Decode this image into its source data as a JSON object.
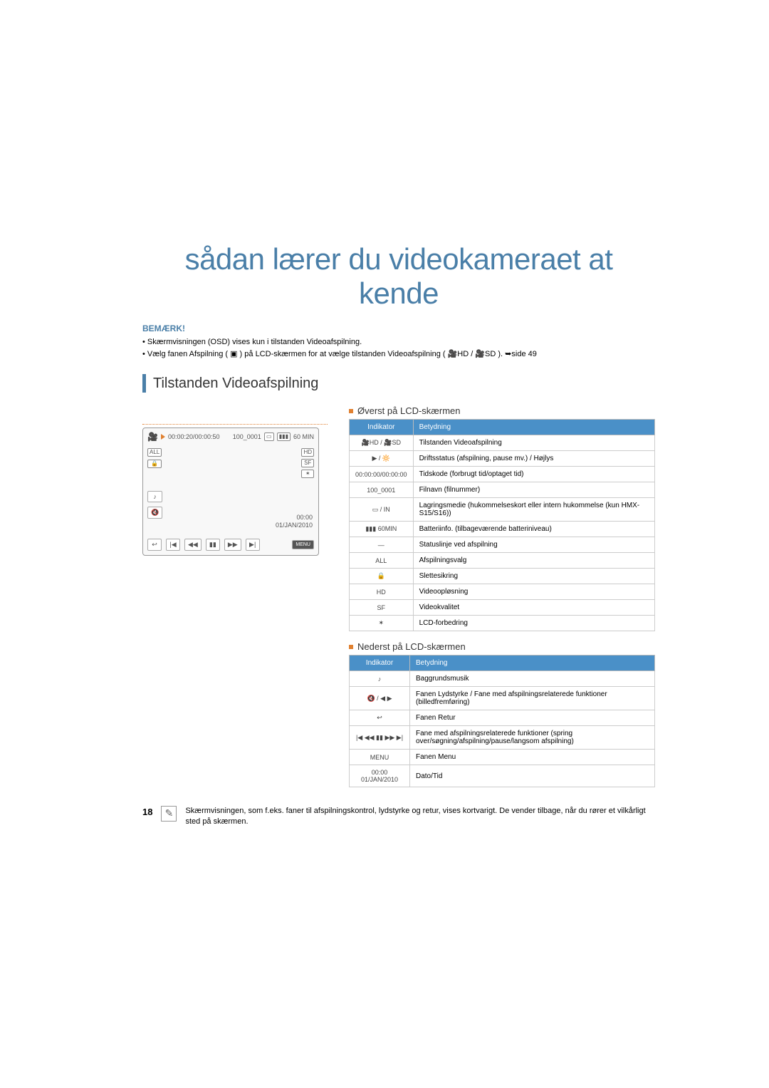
{
  "page": {
    "title": "sådan lærer du videokameraet at kende",
    "note_label": "BEMÆRK!",
    "notes": [
      "Skærmvisningen (OSD) vises kun i tilstanden Videoafspilning.",
      "Vælg fanen Afspilning ( ▣ ) på LCD-skærmen for at vælge tilstanden Videoafspilning ( 🎥HD / 🎥SD ). ➥side 49"
    ],
    "section_title": "Tilstanden Videoafspilning",
    "subhead_top": "Øverst på LCD-skærmen",
    "subhead_bottom": "Nederst på LCD-skærmen",
    "table_headers": {
      "indicator": "Indikator",
      "meaning": "Betydning"
    },
    "top_table": [
      {
        "icon": "🎥HD / 🎥SD",
        "meaning": "Tilstanden Videoafspilning"
      },
      {
        "icon": "▶ / 🔆",
        "meaning": "Driftsstatus (afspilning, pause mv.) / Højlys"
      },
      {
        "icon": "00:00:00/00:00:00",
        "meaning": "Tidskode (forbrugt tid/optaget tid)"
      },
      {
        "icon": "100_0001",
        "meaning": "Filnavn (filnummer)"
      },
      {
        "icon": "▭ / IN",
        "meaning": "Lagringsmedie (hukommelseskort eller intern hukommelse (kun HMX-S15/S16))"
      },
      {
        "icon": "▮▮▮ 60MIN",
        "meaning": "Batteriinfo. (tilbageværende batteriniveau)"
      },
      {
        "icon": "—",
        "meaning": "Statuslinje ved afspilning"
      },
      {
        "icon": "ALL",
        "meaning": "Afspilningsvalg"
      },
      {
        "icon": "🔒",
        "meaning": "Slettesikring"
      },
      {
        "icon": "HD",
        "meaning": "Videoopløsning"
      },
      {
        "icon": "SF",
        "meaning": "Videokvalitet"
      },
      {
        "icon": "✶",
        "meaning": "LCD-forbedring"
      }
    ],
    "bottom_table": [
      {
        "icon": "♪",
        "meaning": "Baggrundsmusik"
      },
      {
        "icon": "🔇 / ◀ ▶",
        "meaning": "Fanen Lydstyrke / Fane med afspilningsrelaterede funktioner (billedfremføring)"
      },
      {
        "icon": "↩",
        "meaning": "Fanen Retur"
      },
      {
        "icon": "|◀ ◀◀ ▮▮ ▶▶ ▶|",
        "meaning": "Fane med afspilningsrelaterede funktioner (spring over/søgning/afspilning/pause/langsom afspilning)"
      },
      {
        "icon": "MENU",
        "meaning": "Fanen Menu"
      },
      {
        "icon": "00:00  01/JAN/2010",
        "meaning": "Dato/Tid"
      }
    ],
    "lcd": {
      "timecode": "00:00:20/00:00:50",
      "filename": "100_0001",
      "battery": "60 MIN",
      "all": "ALL",
      "hd": "HD",
      "sf": "SF",
      "music": "♪",
      "vol": "🔇",
      "back": "↩",
      "date_time": "00:00",
      "date": "01/JAN/2010",
      "menu": "MENU",
      "prev": "|◀",
      "rew": "◀◀",
      "pause": "▮▮",
      "fwd": "▶▶",
      "next": "▶|"
    },
    "footer": {
      "page_number": "18",
      "text": "Skærmvisningen, som f.eks. faner til afspilningskontrol, lydstyrke og retur, vises kortvarigt. De vender tilbage, når du rører et vilkårligt sted på skærmen."
    }
  }
}
